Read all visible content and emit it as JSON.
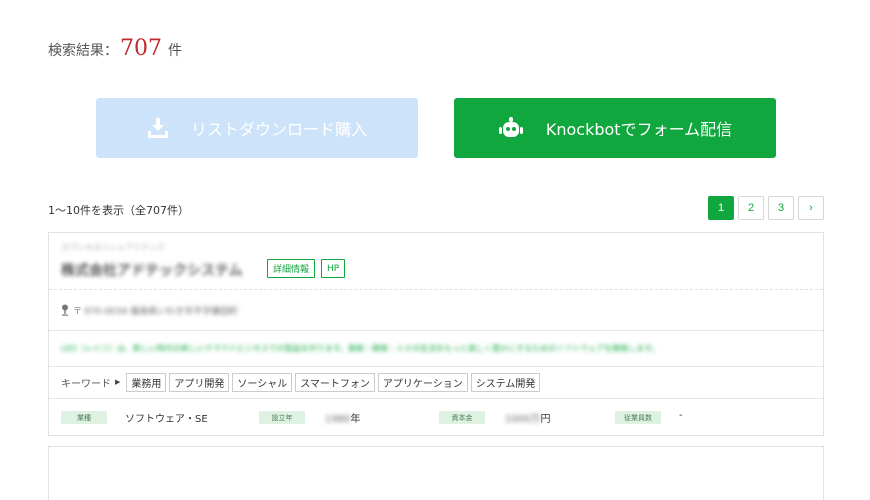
{
  "summary": {
    "label": "検索結果：",
    "count": "707",
    "unit": "件"
  },
  "actions": {
    "download_label": "リストダウンロード購入",
    "knockbot_label": "Knockbotでフォーム配信"
  },
  "listing": {
    "showing_text": "1〜10件を表示（全707件）"
  },
  "pagination": {
    "pages": [
      "1",
      "2",
      "3"
    ],
    "active": "1",
    "next": "›"
  },
  "results": [
    {
      "name": "株式会社アドテックシステム",
      "name_sub": "カブシキガイシャアドテック",
      "detail_label": "詳細情報",
      "hp_label": "HP",
      "postal_mark": "〒",
      "address": "970-0034 福島県いわき市平字鎌田町",
      "description": "LEO（レイジ）は、新しい時代の新しいクラウドビジネスでの製品を作ります。業務・開発・人々の生活をもっと楽しく豊かにするためのソフトウェアを開発します。",
      "keyword_label": "キーワード",
      "keywords": [
        "業務用",
        "アプリ開発",
        "ソーシャル",
        "スマートフォン",
        "アプリケーション",
        "システム開発"
      ],
      "info": {
        "industry_label": "業種",
        "industry": "ソフトウェア・SE",
        "founded_label": "設立年",
        "founded": "1980",
        "founded_unit": "年",
        "capital_label": "資本金",
        "capital": "1000万",
        "capital_unit": "円",
        "employees_label": "従業員数",
        "employees": "-"
      }
    }
  ],
  "colors": {
    "accent_green": "#10a73f",
    "count_red": "#c0282f",
    "download_disabled": "#cde3f9"
  }
}
